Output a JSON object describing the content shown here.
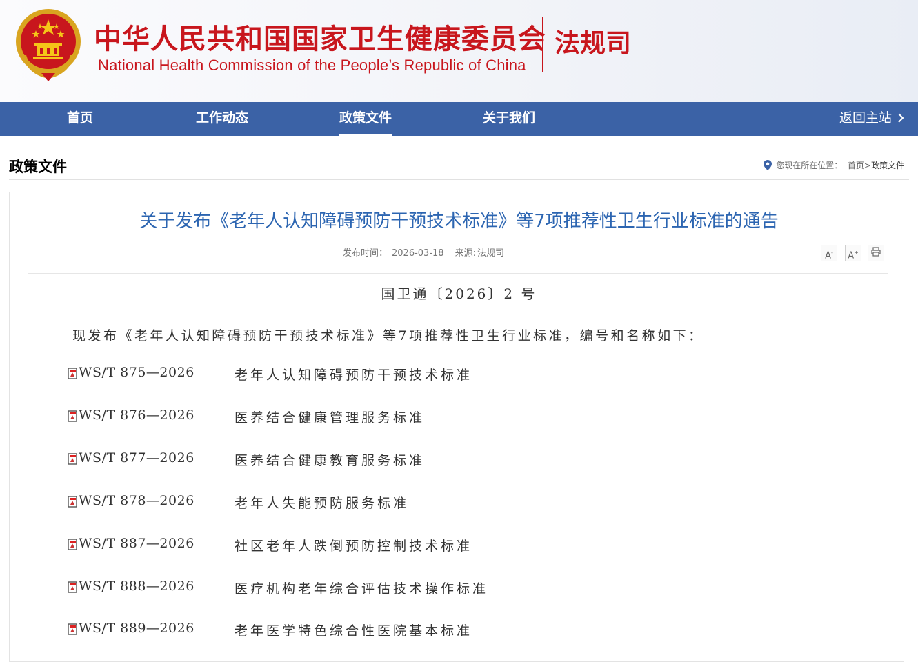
{
  "header": {
    "title_cn": "中华人民共和国国家卫生健康委员会",
    "title_en": "National Health Commission of the People’s Republic of China",
    "department": "法规司",
    "emblem_icon": "national-emblem-icon"
  },
  "nav": {
    "items": [
      {
        "label": "首页"
      },
      {
        "label": "工作动态"
      },
      {
        "label": "政策文件",
        "active": true
      },
      {
        "label": "关于我们"
      }
    ],
    "back_label": "返回主站"
  },
  "section": {
    "title": "政策文件",
    "breadcrumb_prefix": "您现在所在位置：",
    "breadcrumb_home": "首页",
    "breadcrumb_sep": ">",
    "breadcrumb_current": "政策文件"
  },
  "article": {
    "title": "关于发布《老年人认知障碍预防干预技术标准》等7项推荐性卫生行业标准的通告",
    "publish_label": "发布时间：",
    "publish_date": "2026-03-18",
    "source_label": "来源:",
    "source": "法规司",
    "font_smaller": "A",
    "font_larger": "A",
    "doc_number": "国卫通〔2026〕2 号",
    "intro": "现发布《老年人认知障碍预防干预技术标准》等7项推荐性卫生行业标准，编号和名称如下：",
    "standards": [
      {
        "code": "WS/T 875—2026",
        "name": "老年人认知障碍预防干预技术标准"
      },
      {
        "code": "WS/T 876—2026",
        "name": "医养结合健康管理服务标准"
      },
      {
        "code": "WS/T 877—2026",
        "name": "医养结合健康教育服务标准"
      },
      {
        "code": "WS/T 878—2026",
        "name": "老年人失能预防服务标准"
      },
      {
        "code": "WS/T 887—2026",
        "name": "社区老年人跌倒预防控制技术标准"
      },
      {
        "code": "WS/T 888—2026",
        "name": "医疗机构老年综合评估技术操作标准"
      },
      {
        "code": "WS/T 889—2026",
        "name": "老年医学特色综合性医院基本标准"
      }
    ]
  },
  "colors": {
    "brand_red": "#c8161d",
    "nav_blue": "#3b62a6",
    "title_blue": "#2c65b1"
  }
}
